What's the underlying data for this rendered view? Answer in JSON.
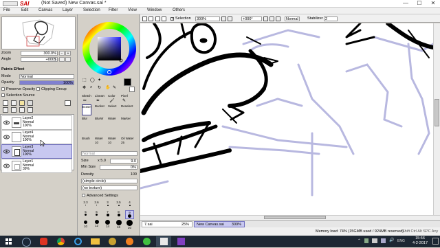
{
  "window": {
    "app": "SAI",
    "title": "(Not Saved) New Canvas.sai *",
    "minimize": "—",
    "maximize": "☐",
    "close": "✕"
  },
  "menu": [
    "File",
    "Edit",
    "Canvas",
    "Layer",
    "Selection",
    "Filter",
    "View",
    "Window",
    "Others"
  ],
  "navigator": {
    "zoom_label": "Zoom",
    "zoom_value": "300.0%",
    "angle_label": "Angle",
    "angle_value": "+000$"
  },
  "layer_props": {
    "title": "Paints Effect",
    "mode_label": "Mode",
    "mode_value": "Normal",
    "opacity_label": "Opacity",
    "opacity_value": "100%",
    "preserve_opacity": "Preserve Opacity",
    "clipping_group": "Clipping Group",
    "selection_source": "Selection Source"
  },
  "layers": [
    {
      "name": "Layer2",
      "mode": "Normal",
      "opacity": "100%"
    },
    {
      "name": "Layer4",
      "mode": "Normal",
      "opacity": "100%"
    },
    {
      "name": "Layer3",
      "mode": "Normal",
      "opacity": "100%"
    },
    {
      "name": "Layer1",
      "mode": "Normal",
      "opacity": "39%"
    }
  ],
  "tools": {
    "row1": [
      "Sketch",
      "Lineart",
      "Color",
      "Pixel"
    ],
    "row2": [
      "Eraser",
      "Bucket",
      "Select",
      "Deselect"
    ],
    "row3": [
      "Blur",
      "BlurW",
      "Water",
      "Marker"
    ],
    "row4": [
      "Brush",
      "Water",
      "Water",
      "Oil Water"
    ],
    "row4_sizes": [
      "",
      "10",
      "10",
      "25"
    ],
    "normal_label": "Normal"
  },
  "brush": {
    "size_label": "Size",
    "size_mult": "x 5.0",
    "size_value": "9.0",
    "minsize_label": "Min Size",
    "minsize_value": "0%",
    "density_label": "Density",
    "density_value": "100",
    "shape": "(simple circle)",
    "texture": "(no texture)",
    "advanced": "Advanced Settings",
    "sizes_row1": [
      "2.3",
      "2.6",
      "3",
      "3.5",
      "4"
    ],
    "sizes_row2": [
      "5",
      "6",
      "7",
      "8",
      "9"
    ],
    "sizes_row3": [
      "10",
      "12",
      "14",
      "16",
      "20"
    ]
  },
  "toolbar": {
    "selection_label": "Selection",
    "zoom": "300%",
    "angle": "+000°",
    "mode": "Normal",
    "stabilizer_label": "Stabilizer",
    "stabilizer": "2"
  },
  "tabs": [
    {
      "name": "7.sai",
      "zoom": "25%"
    },
    {
      "name": "New Canvas.sai",
      "zoom": "300%"
    }
  ],
  "status": {
    "memory": "Memory load: 74% (15GMB used / 924MB reserved)",
    "keys": "Shift Ctrl Alt SPC Any"
  },
  "taskbar": {
    "lang": "ENG",
    "time": "15:56",
    "date": "4-2-2017"
  },
  "colors": {
    "accent": "#1010a0",
    "selected_layer": "#c8c8f0",
    "taskbar": "#1d2733",
    "sketch_lines": "#b8b8e0"
  }
}
